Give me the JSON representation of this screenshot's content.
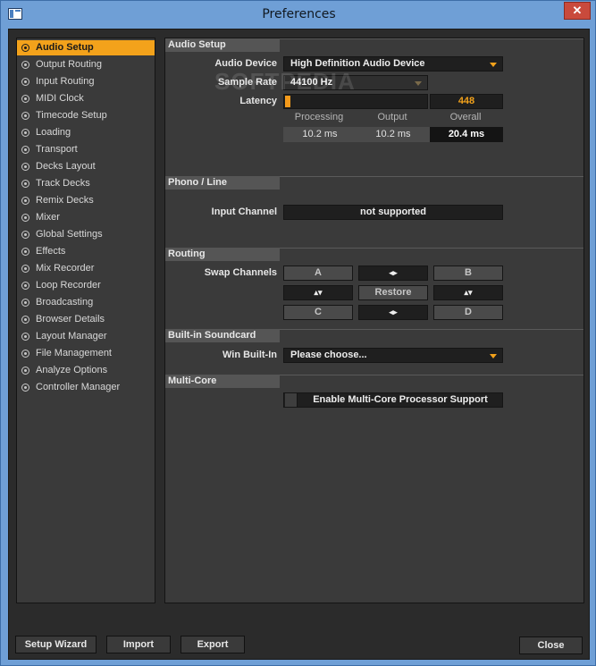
{
  "window": {
    "title": "Preferences",
    "close_glyph": "✕"
  },
  "watermark": "SOFTPEDIA",
  "sidebar": {
    "items": [
      {
        "label": "Audio Setup",
        "active": true
      },
      {
        "label": "Output Routing"
      },
      {
        "label": "Input Routing"
      },
      {
        "label": "MIDI Clock"
      },
      {
        "label": "Timecode Setup"
      },
      {
        "label": "Loading"
      },
      {
        "label": "Transport"
      },
      {
        "label": "Decks Layout"
      },
      {
        "label": "Track Decks"
      },
      {
        "label": "Remix Decks"
      },
      {
        "label": "Mixer"
      },
      {
        "label": "Global Settings"
      },
      {
        "label": "Effects"
      },
      {
        "label": "Mix Recorder"
      },
      {
        "label": "Loop Recorder"
      },
      {
        "label": "Broadcasting"
      },
      {
        "label": "Browser Details"
      },
      {
        "label": "Layout Manager"
      },
      {
        "label": "File Management"
      },
      {
        "label": "Analyze Options"
      },
      {
        "label": "Controller Manager"
      }
    ]
  },
  "audio_setup": {
    "header": "Audio Setup",
    "device_label": "Audio Device",
    "device_value": "High Definition Audio Device",
    "sample_rate_label": "Sample Rate",
    "sample_rate_value": "44100 Hz",
    "latency_label": "Latency",
    "latency_value": "448",
    "latency_fraction": 0.03,
    "col_processing": "Processing",
    "col_output": "Output",
    "col_overall": "Overall",
    "processing_value": "10.2 ms",
    "output_value": "10.2 ms",
    "overall_value": "20.4 ms"
  },
  "phono": {
    "header": "Phono / Line",
    "input_channel_label": "Input Channel",
    "input_channel_value": "not supported"
  },
  "routing": {
    "header": "Routing",
    "swap_label": "Swap Channels",
    "a": "A",
    "b": "B",
    "c": "C",
    "d": "D",
    "restore": "Restore",
    "swap_lr": "◂▸",
    "swap_ud": "▴▾"
  },
  "soundcard": {
    "header": "Built-in Soundcard",
    "win_label": "Win Built-In",
    "win_value": "Please choose..."
  },
  "multicore": {
    "header": "Multi-Core",
    "enable_label": "Enable Multi-Core Processor Support"
  },
  "footer": {
    "setup_wizard": "Setup Wizard",
    "import": "Import",
    "export": "Export",
    "close": "Close"
  },
  "colors": {
    "accent": "#f3a21b",
    "panel": "#3a3a3a",
    "titlebar": "#6f9fd6"
  }
}
